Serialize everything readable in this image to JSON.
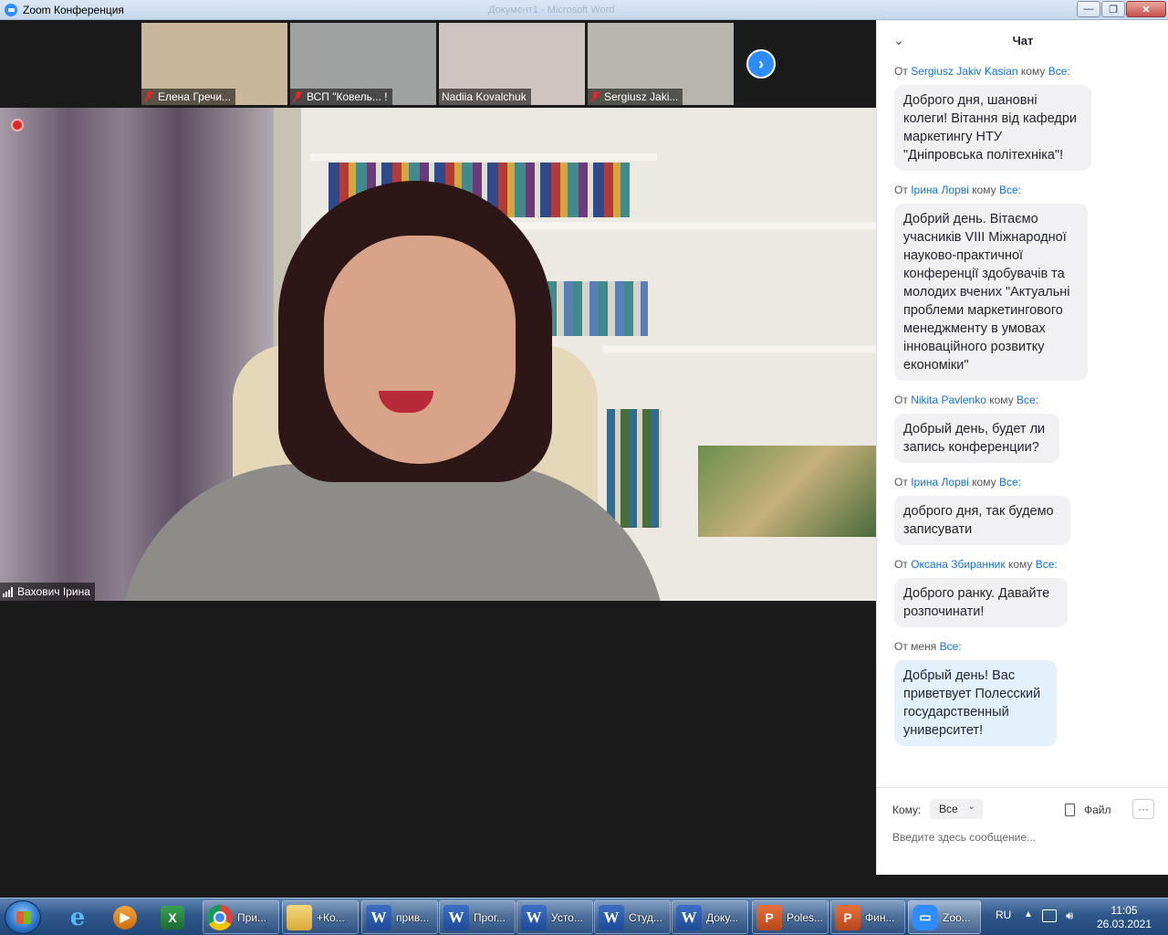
{
  "window": {
    "title": "Zoom Конференция",
    "ghost_title": "Документ1 - Microsoft Word",
    "buttons": {
      "minimize": "—",
      "restore": "❐",
      "close": "✕"
    }
  },
  "thumbnails": [
    {
      "name": "Елена Гречи...",
      "muted": true,
      "bg": "#c9b79c"
    },
    {
      "name": "ВСП \"Ковель... !",
      "muted": true,
      "bg": "#9fa2a0"
    },
    {
      "name": "Nadiia Kovalchuk",
      "muted": false,
      "bg": "#cfc4c2"
    },
    {
      "name": "Sergiusz Jaki...",
      "muted": true,
      "bg": "#b7b5ad"
    }
  ],
  "main_video": {
    "speaker_name": "Вахович Ірина",
    "recording": true
  },
  "chat": {
    "title": "Чат",
    "to_word": "кому",
    "from_word": "От",
    "messages": [
      {
        "sender": "Sergiusz Jakiv Kasian",
        "recipient": "Все:",
        "text": "Доброго дня, шановні колеги! Вітання від кафедри маркетингу НТУ \"Дніпровська політехніка\"!"
      },
      {
        "sender": "Ірина Лорві",
        "recipient": "Все:",
        "text": "Добрий день. Вітаємо учасників VIII Міжнародної науково-практичної конференції здобувачів та молодих вчених \"Актуальні проблеми маркетингового менеджменту в умовах інноваційного розвитку економіки\""
      },
      {
        "sender": "Nikita Pavlenko",
        "recipient": "Все:",
        "text": "Добрый день, будет ли запись конференции?"
      },
      {
        "sender": "Ірина Лорві",
        "recipient": "Все:",
        "text": "доброго дня, так будемо записувати"
      },
      {
        "sender": "Оксана Збиранник",
        "recipient": "Все:",
        "text": "Доброго ранку. Давайте розпочинати!"
      }
    ],
    "own_message": {
      "meta": "От меня",
      "recipient": "Все:",
      "text": "Добрый день! Вас приветвует Полесский государственный университет!"
    },
    "composer": {
      "to_label": "Кому:",
      "to_value": "Все",
      "file_label": "Файл",
      "more_label": "···",
      "placeholder": "Введите здесь сообщение..."
    }
  },
  "taskbar": {
    "pinned": [
      "internet-explorer",
      "media-player",
      "excel"
    ],
    "items": [
      {
        "label": "При...",
        "icon": "chrome-icon"
      },
      {
        "label": "+Ко...",
        "icon": "folder-icon"
      },
      {
        "label": "прив...",
        "icon": "word-icon"
      },
      {
        "label": "Прог...",
        "icon": "word-icon"
      },
      {
        "label": "Усто...",
        "icon": "word-icon"
      },
      {
        "label": "Студ...",
        "icon": "word-icon"
      },
      {
        "label": "Доку...",
        "icon": "word-icon"
      },
      {
        "label": "Poles...",
        "icon": "powerpoint-icon"
      },
      {
        "label": "Фин...",
        "icon": "powerpoint-icon"
      },
      {
        "label": "Zoo...",
        "icon": "zoom-icon"
      }
    ],
    "tray": {
      "lang": "RU",
      "time": "11:05",
      "date": "26.03.2021"
    }
  }
}
